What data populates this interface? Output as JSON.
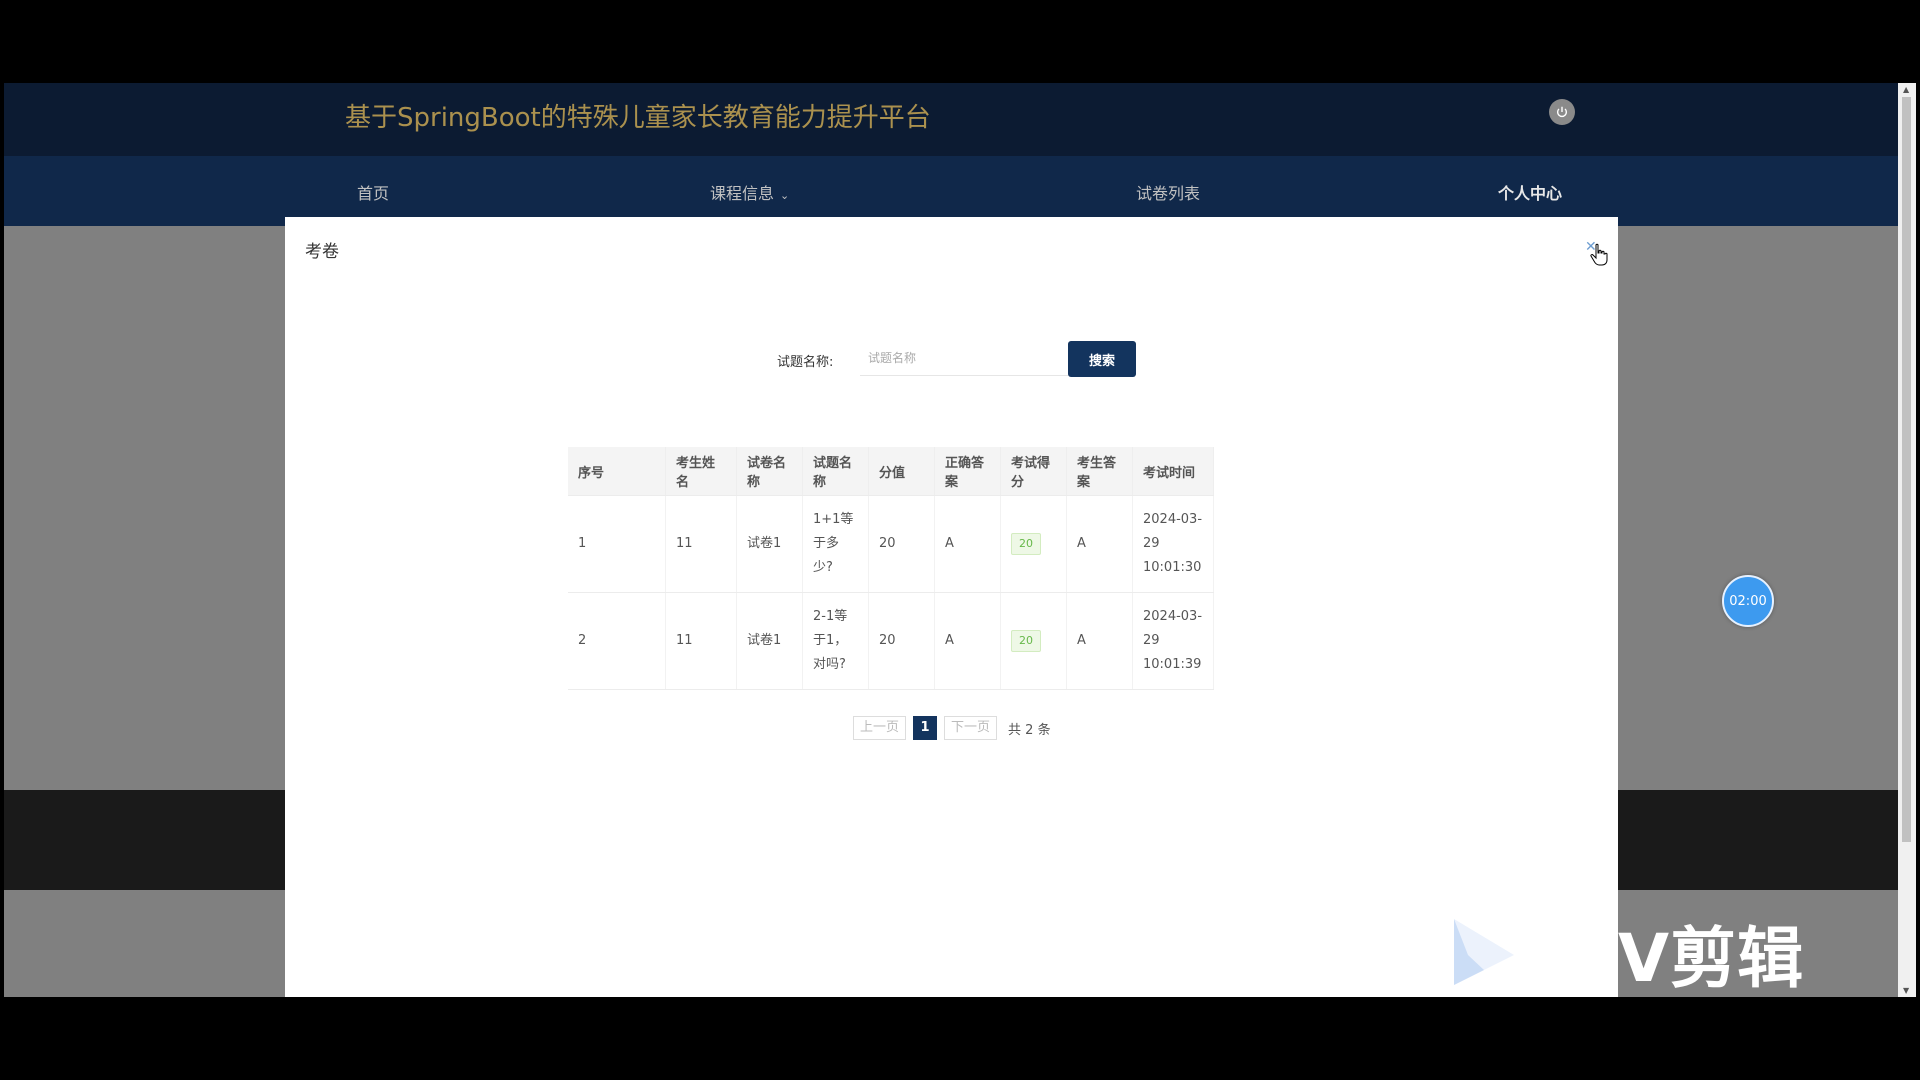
{
  "header": {
    "site_title": "基于SpringBoot的特殊儿童家长教育能力提升平台"
  },
  "nav": {
    "items": [
      {
        "label": "首页"
      },
      {
        "label": "课程信息",
        "has_dropdown": true
      },
      {
        "label": "试卷列表"
      },
      {
        "label": "个人中心",
        "active": true
      }
    ]
  },
  "modal": {
    "title": "考卷",
    "search": {
      "label": "试题名称:",
      "placeholder": "试题名称",
      "value": "",
      "button_label": "搜索"
    },
    "table": {
      "headers": [
        "序号",
        "考生姓名",
        "试卷名称",
        "试题名称",
        "分值",
        "正确答案",
        "考试得分",
        "考生答案",
        "考试时间"
      ],
      "rows": [
        {
          "index": "1",
          "student_name": "11",
          "paper_name": "试卷1",
          "question_name": "1+1等于多少?",
          "points": "20",
          "correct_answer": "A",
          "score": "20",
          "student_answer": "A",
          "exam_time": "2024-03-29 10:01:30"
        },
        {
          "index": "2",
          "student_name": "11",
          "paper_name": "试卷1",
          "question_name": "2-1等于1，对吗?",
          "points": "20",
          "correct_answer": "A",
          "score": "20",
          "student_answer": "A",
          "exam_time": "2024-03-29 10:01:39"
        }
      ]
    },
    "pagination": {
      "prev_label": "上一页",
      "current_page": "1",
      "next_label": "下一页",
      "total_label": "共 2 条"
    }
  },
  "timer": {
    "text": "02:00"
  },
  "watermark": {
    "text": "V剪辑"
  },
  "colors": {
    "header_bg": "#0c1b32",
    "nav_bg": "#10284a",
    "title_gold": "#ab914e",
    "primary_button": "#13345e",
    "score_badge_text": "#67b84a",
    "timer_bubble": "#3d9aef"
  }
}
